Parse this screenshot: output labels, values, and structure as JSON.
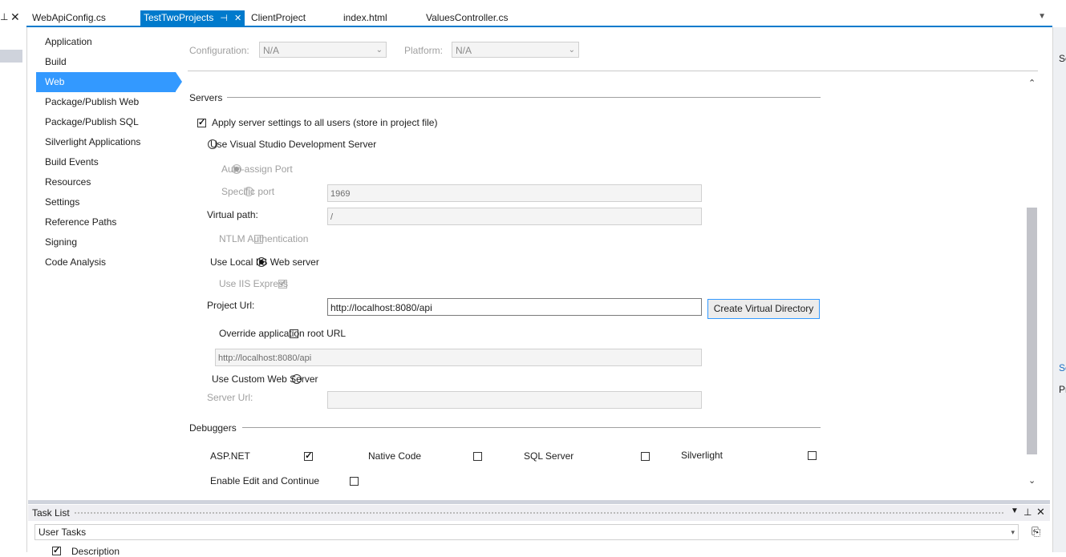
{
  "tabs": [
    {
      "label": "WebApiConfig.cs",
      "active": false
    },
    {
      "label": "TestTwoProjects",
      "active": true
    },
    {
      "label": "ClientProject",
      "active": false
    },
    {
      "label": "index.html",
      "active": false
    },
    {
      "label": "ValuesController.cs",
      "active": false
    }
  ],
  "nav": [
    "Application",
    "Build",
    "Web",
    "Package/Publish Web",
    "Package/Publish SQL",
    "Silverlight Applications",
    "Build Events",
    "Resources",
    "Settings",
    "Reference Paths",
    "Signing",
    "Code Analysis"
  ],
  "nav_selected": "Web",
  "config": {
    "configuration_label": "Configuration:",
    "configuration_value": "N/A",
    "platform_label": "Platform:",
    "platform_value": "N/A"
  },
  "servers": {
    "header": "Servers",
    "apply_all": "Apply server settings to all users (store in project file)",
    "use_vs_dev": "Use Visual Studio Development Server",
    "auto_assign": "Auto-assign Port",
    "specific_port": "Specific port",
    "specific_port_value": "1969",
    "virtual_path_label": "Virtual path:",
    "virtual_path_value": "/",
    "ntlm": "NTLM Authentication",
    "use_local_iis": "Use Local IIS Web server",
    "use_iis_express": "Use IIS Express",
    "project_url_label": "Project Url:",
    "project_url_value": "http://localhost:8080/api",
    "create_vdir": "Create Virtual Directory",
    "override_root": "Override application root URL",
    "override_value": "http://localhost:8080/api",
    "use_custom": "Use Custom Web Server",
    "server_url_label": "Server Url:",
    "server_url_value": ""
  },
  "debuggers": {
    "header": "Debuggers",
    "aspnet": "ASP.NET",
    "native": "Native Code",
    "sql": "SQL Server",
    "silverlight": "Silverlight",
    "edit_continue": "Enable Edit and Continue"
  },
  "tasklist": {
    "title": "Task List",
    "filter_value": "User Tasks",
    "col_description": "Description"
  },
  "right_strip": {
    "t1": "Se",
    "t2": "Sc",
    "t3": "Pr"
  }
}
